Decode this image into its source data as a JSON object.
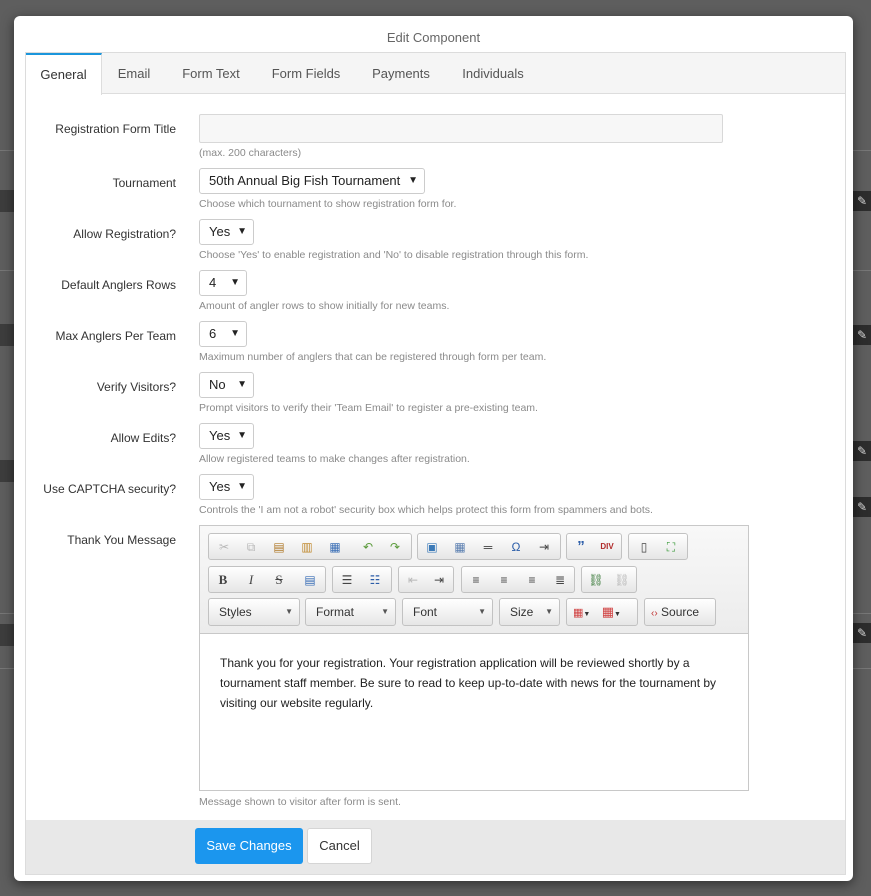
{
  "modal": {
    "title": "Edit Component",
    "tabs": [
      "General",
      "Email",
      "Form Text",
      "Form Fields",
      "Payments",
      "Individuals"
    ]
  },
  "fields": {
    "registration_form_title": {
      "label": "Registration Form Title",
      "value": "",
      "help": "(max. 200 characters)"
    },
    "tournament": {
      "label": "Tournament",
      "value": "50th Annual Big Fish Tournament",
      "help": "Choose which tournament to show registration form for."
    },
    "allow_registration": {
      "label": "Allow Registration?",
      "value": "Yes",
      "help": "Choose 'Yes' to enable registration and 'No' to disable registration through this form."
    },
    "default_anglers_rows": {
      "label": "Default Anglers Rows",
      "value": "4",
      "help": "Amount of angler rows to show initially for new teams."
    },
    "max_anglers_per_team": {
      "label": "Max Anglers Per Team",
      "value": "6",
      "help": "Maximum number of anglers that can be registered through form per team."
    },
    "verify_visitors": {
      "label": "Verify Visitors?",
      "value": "No",
      "help": "Prompt visitors to verify their 'Team Email' to register a pre-existing team."
    },
    "allow_edits": {
      "label": "Allow Edits?",
      "value": "Yes",
      "help": "Allow registered teams to make changes after registration."
    },
    "use_captcha": {
      "label": "Use CAPTCHA security?",
      "value": "Yes",
      "help": "Controls the 'I am not a robot' security box which helps protect this form from spammers and bots."
    },
    "thank_you_message": {
      "label": "Thank You Message",
      "help": "Message shown to visitor after form is sent.",
      "content": "Thank you for your registration. Your registration application will be reviewed shortly by a tournament staff member. Be sure to read to keep up-to-date with news for the tournament by visiting our website regularly."
    }
  },
  "editor_toolbar": {
    "styles": "Styles",
    "format": "Format",
    "font": "Font",
    "size": "Size",
    "source": "Source"
  },
  "footer": {
    "save": "Save Changes",
    "cancel": "Cancel"
  },
  "colors": {
    "primary": "#1b96ee",
    "active_tab_border": "#1b96dc"
  }
}
